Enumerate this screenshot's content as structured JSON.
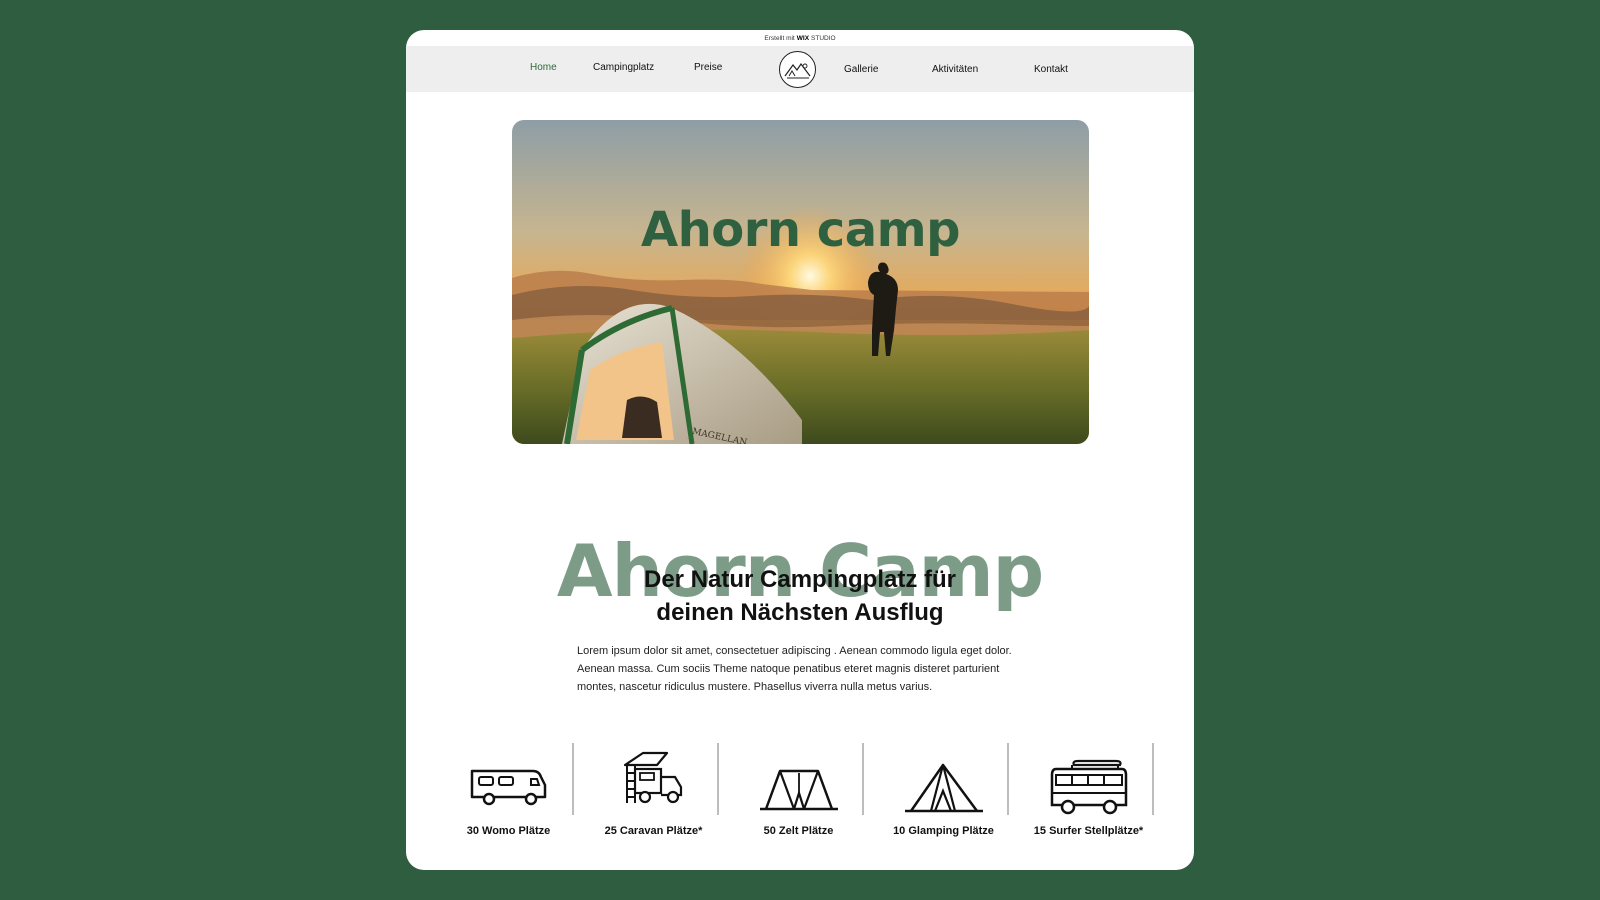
{
  "wix_banner": {
    "prefix": "Erstellt mit",
    "brand": "WIX",
    "suffix": "STUDIO"
  },
  "nav": {
    "items": [
      {
        "label": "Home",
        "active": true
      },
      {
        "label": "Campingplatz"
      },
      {
        "label": "Preise"
      },
      {
        "label": "Gallerie"
      },
      {
        "label": "Aktivitäten"
      },
      {
        "label": "Kontakt"
      }
    ]
  },
  "hero": {
    "title": "Ahorn camp",
    "tent_brand": "MAGELLAN"
  },
  "intro": {
    "big_word": "Ahorn Camp",
    "subtitle_line1": "Der Natur Campingplatz für",
    "subtitle_line2": "deinen Nächsten Ausflug",
    "body": "Lorem ipsum dolor sit amet, consectetuer adipiscing . Aenean commodo ligula eget dolor. Aenean massa. Cum sociis Theme natoque penatibus eteret magnis disteret parturient montes, nascetur ridiculus mustere. Phasellus viverra nulla metus varius."
  },
  "features": [
    {
      "label": "30 Womo Plätze",
      "icon": "motorhome-icon"
    },
    {
      "label": "25 Caravan Plätze*",
      "icon": "rooftop-tent-truck-icon"
    },
    {
      "label": "50 Zelt Plätze",
      "icon": "tent-icon"
    },
    {
      "label": "10 Glamping Plätze",
      "icon": "glamping-tent-icon"
    },
    {
      "label": "15 Surfer Stellplätze*",
      "icon": "surf-van-icon"
    }
  ],
  "colors": {
    "background": "#2f5d40",
    "accent_green": "#2f6140",
    "muted_green": "#7d9c88",
    "nav_bg": "#eeeeee"
  }
}
